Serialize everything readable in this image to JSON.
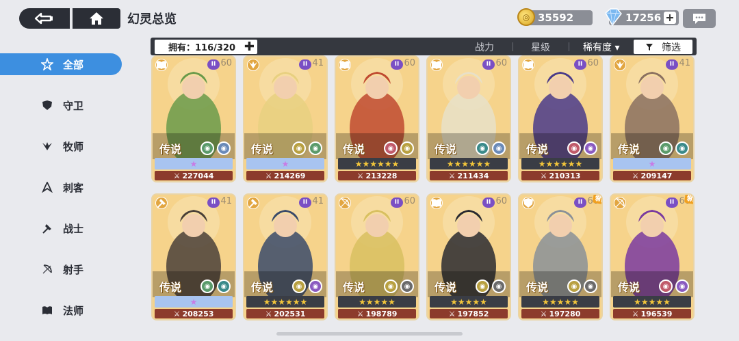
{
  "header": {
    "title": "幻灵总览",
    "gold": "35592",
    "gems": "17256"
  },
  "sidebar": {
    "items": [
      {
        "label": "全部",
        "icon": "star-outline-icon",
        "active": true
      },
      {
        "label": "守卫",
        "icon": "shield-icon",
        "active": false
      },
      {
        "label": "牧师",
        "icon": "wing-icon",
        "active": false
      },
      {
        "label": "刺客",
        "icon": "dagger-icon",
        "active": false
      },
      {
        "label": "战士",
        "icon": "axe-icon",
        "active": false
      },
      {
        "label": "射手",
        "icon": "bow-icon",
        "active": false
      },
      {
        "label": "法师",
        "icon": "book-icon",
        "active": false
      }
    ]
  },
  "filter": {
    "owned": "拥有：116/320",
    "sort_power": "战力",
    "sort_star": "星级",
    "sort_rarity": "稀有度 ▾",
    "filter_label": "筛选"
  },
  "colors": {
    "accent": "#3d8fe0",
    "dark": "#2b2e36",
    "card": "#f6d38b",
    "power": "#8c3b2c"
  },
  "cards": [
    {
      "level": "60",
      "rarity": "传说",
      "power": "227044",
      "stars": "★",
      "stars_style": "purple",
      "class_icon": "book-icon",
      "elements": [
        "#5a9a6a",
        "#6a8ab8"
      ],
      "hue": "#6a9a4a",
      "new": ""
    },
    {
      "level": "41",
      "rarity": "传说",
      "power": "214269",
      "stars": "★",
      "stars_style": "purple",
      "class_icon": "wing-icon",
      "elements": [
        "#b8a040",
        "#5a9a6a"
      ],
      "hue": "#e8d080",
      "new": ""
    },
    {
      "level": "60",
      "rarity": "传说",
      "power": "213228",
      "stars": "★★★★★★",
      "stars_style": "gold",
      "class_icon": "book-icon",
      "elements": [
        "#c05a6a",
        "#b8a040"
      ],
      "hue": "#c04a30",
      "new": ""
    },
    {
      "level": "60",
      "rarity": "传说",
      "power": "211434",
      "stars": "★★★★★★",
      "stars_style": "gold",
      "class_icon": "book-icon",
      "elements": [
        "#3a8a8a",
        "#6a8ab8"
      ],
      "hue": "#e8e0c8",
      "new": ""
    },
    {
      "level": "60",
      "rarity": "传说",
      "power": "210313",
      "stars": "★★★★★★",
      "stars_style": "gold",
      "class_icon": "book-icon",
      "elements": [
        "#c05a6a",
        "#8a5ac0"
      ],
      "hue": "#4a3a8a",
      "new": ""
    },
    {
      "level": "41",
      "rarity": "传说",
      "power": "209147",
      "stars": "★",
      "stars_style": "purple",
      "class_icon": "wing-icon",
      "elements": [
        "#5a9a6a",
        "#3a8a8a"
      ],
      "hue": "#8a7060",
      "new": ""
    },
    {
      "level": "41",
      "rarity": "传说",
      "power": "208253",
      "stars": "★",
      "stars_style": "purple",
      "class_icon": "axe-icon",
      "elements": [
        "#5a9a6a",
        "#3a8a8a"
      ],
      "hue": "#4a4038",
      "new": ""
    },
    {
      "level": "41",
      "rarity": "传说",
      "power": "202531",
      "stars": "★★★★★★",
      "stars_style": "gold",
      "class_icon": "axe-icon",
      "elements": [
        "#b8a040",
        "#8a5ac0"
      ],
      "hue": "#3a4a6a",
      "new": ""
    },
    {
      "level": "60",
      "rarity": "传说",
      "power": "198789",
      "stars": "★★★★★",
      "stars_style": "gold",
      "class_icon": "bow-icon",
      "elements": [
        "#b8a040",
        "#6a6a6a"
      ],
      "hue": "#d8c060",
      "new": ""
    },
    {
      "level": "60",
      "rarity": "传说",
      "power": "197852",
      "stars": "★★★★★",
      "stars_style": "gold",
      "class_icon": "book-icon",
      "elements": [
        "#b8a040",
        "#6a6a6a"
      ],
      "hue": "#2a2a30",
      "new": ""
    },
    {
      "level": "60",
      "rarity": "传说",
      "power": "197280",
      "stars": "★★★★★",
      "stars_style": "gold",
      "class_icon": "shield-icon",
      "elements": [
        "#b8a040",
        "#6a6a6a"
      ],
      "hue": "#8a9098",
      "new": "新"
    },
    {
      "level": "60",
      "rarity": "传说",
      "power": "196539",
      "stars": "★★★★★",
      "stars_style": "gold",
      "class_icon": "bow-icon",
      "elements": [
        "#c05a6a",
        "#8a5ac0"
      ],
      "hue": "#7a3aa0",
      "new": "新"
    }
  ]
}
